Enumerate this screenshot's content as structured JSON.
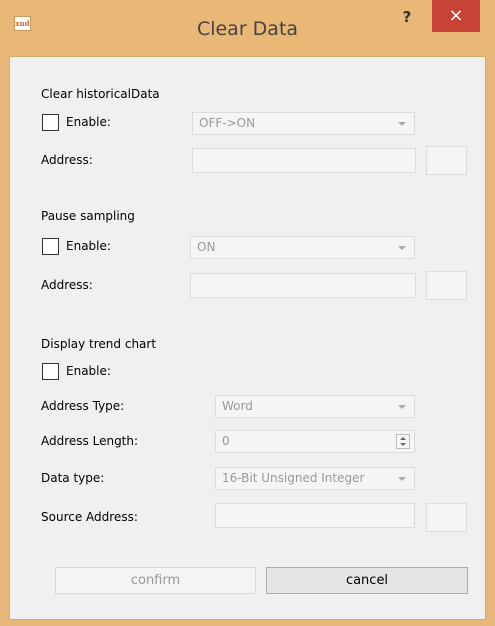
{
  "window": {
    "title": "Clear Data",
    "icon_text": "xnd",
    "help_label": "?",
    "close_label": "×",
    "accent_color": "#e9b877",
    "close_color": "#c74336"
  },
  "clear_history": {
    "heading": "Clear historicalData",
    "enable_label": "Enable:",
    "enabled": false,
    "trigger_value": "OFF->ON",
    "address_label": "Address:",
    "address_value": ""
  },
  "pause_sampling": {
    "heading": "Pause sampling",
    "enable_label": "Enable:",
    "enabled": false,
    "trigger_value": "ON",
    "address_label": "Address:",
    "address_value": ""
  },
  "trend_chart": {
    "heading": "Display trend chart",
    "enable_label": "Enable:",
    "enabled": false,
    "address_type_label": "Address Type:",
    "address_type_value": "Word",
    "address_length_label": "Address Length:",
    "address_length_value": "0",
    "data_type_label": "Data type:",
    "data_type_value": "16-Bit Unsigned Integer",
    "source_address_label": "Source Address:",
    "source_address_value": ""
  },
  "buttons": {
    "confirm": "confirm",
    "cancel": "cancel"
  }
}
